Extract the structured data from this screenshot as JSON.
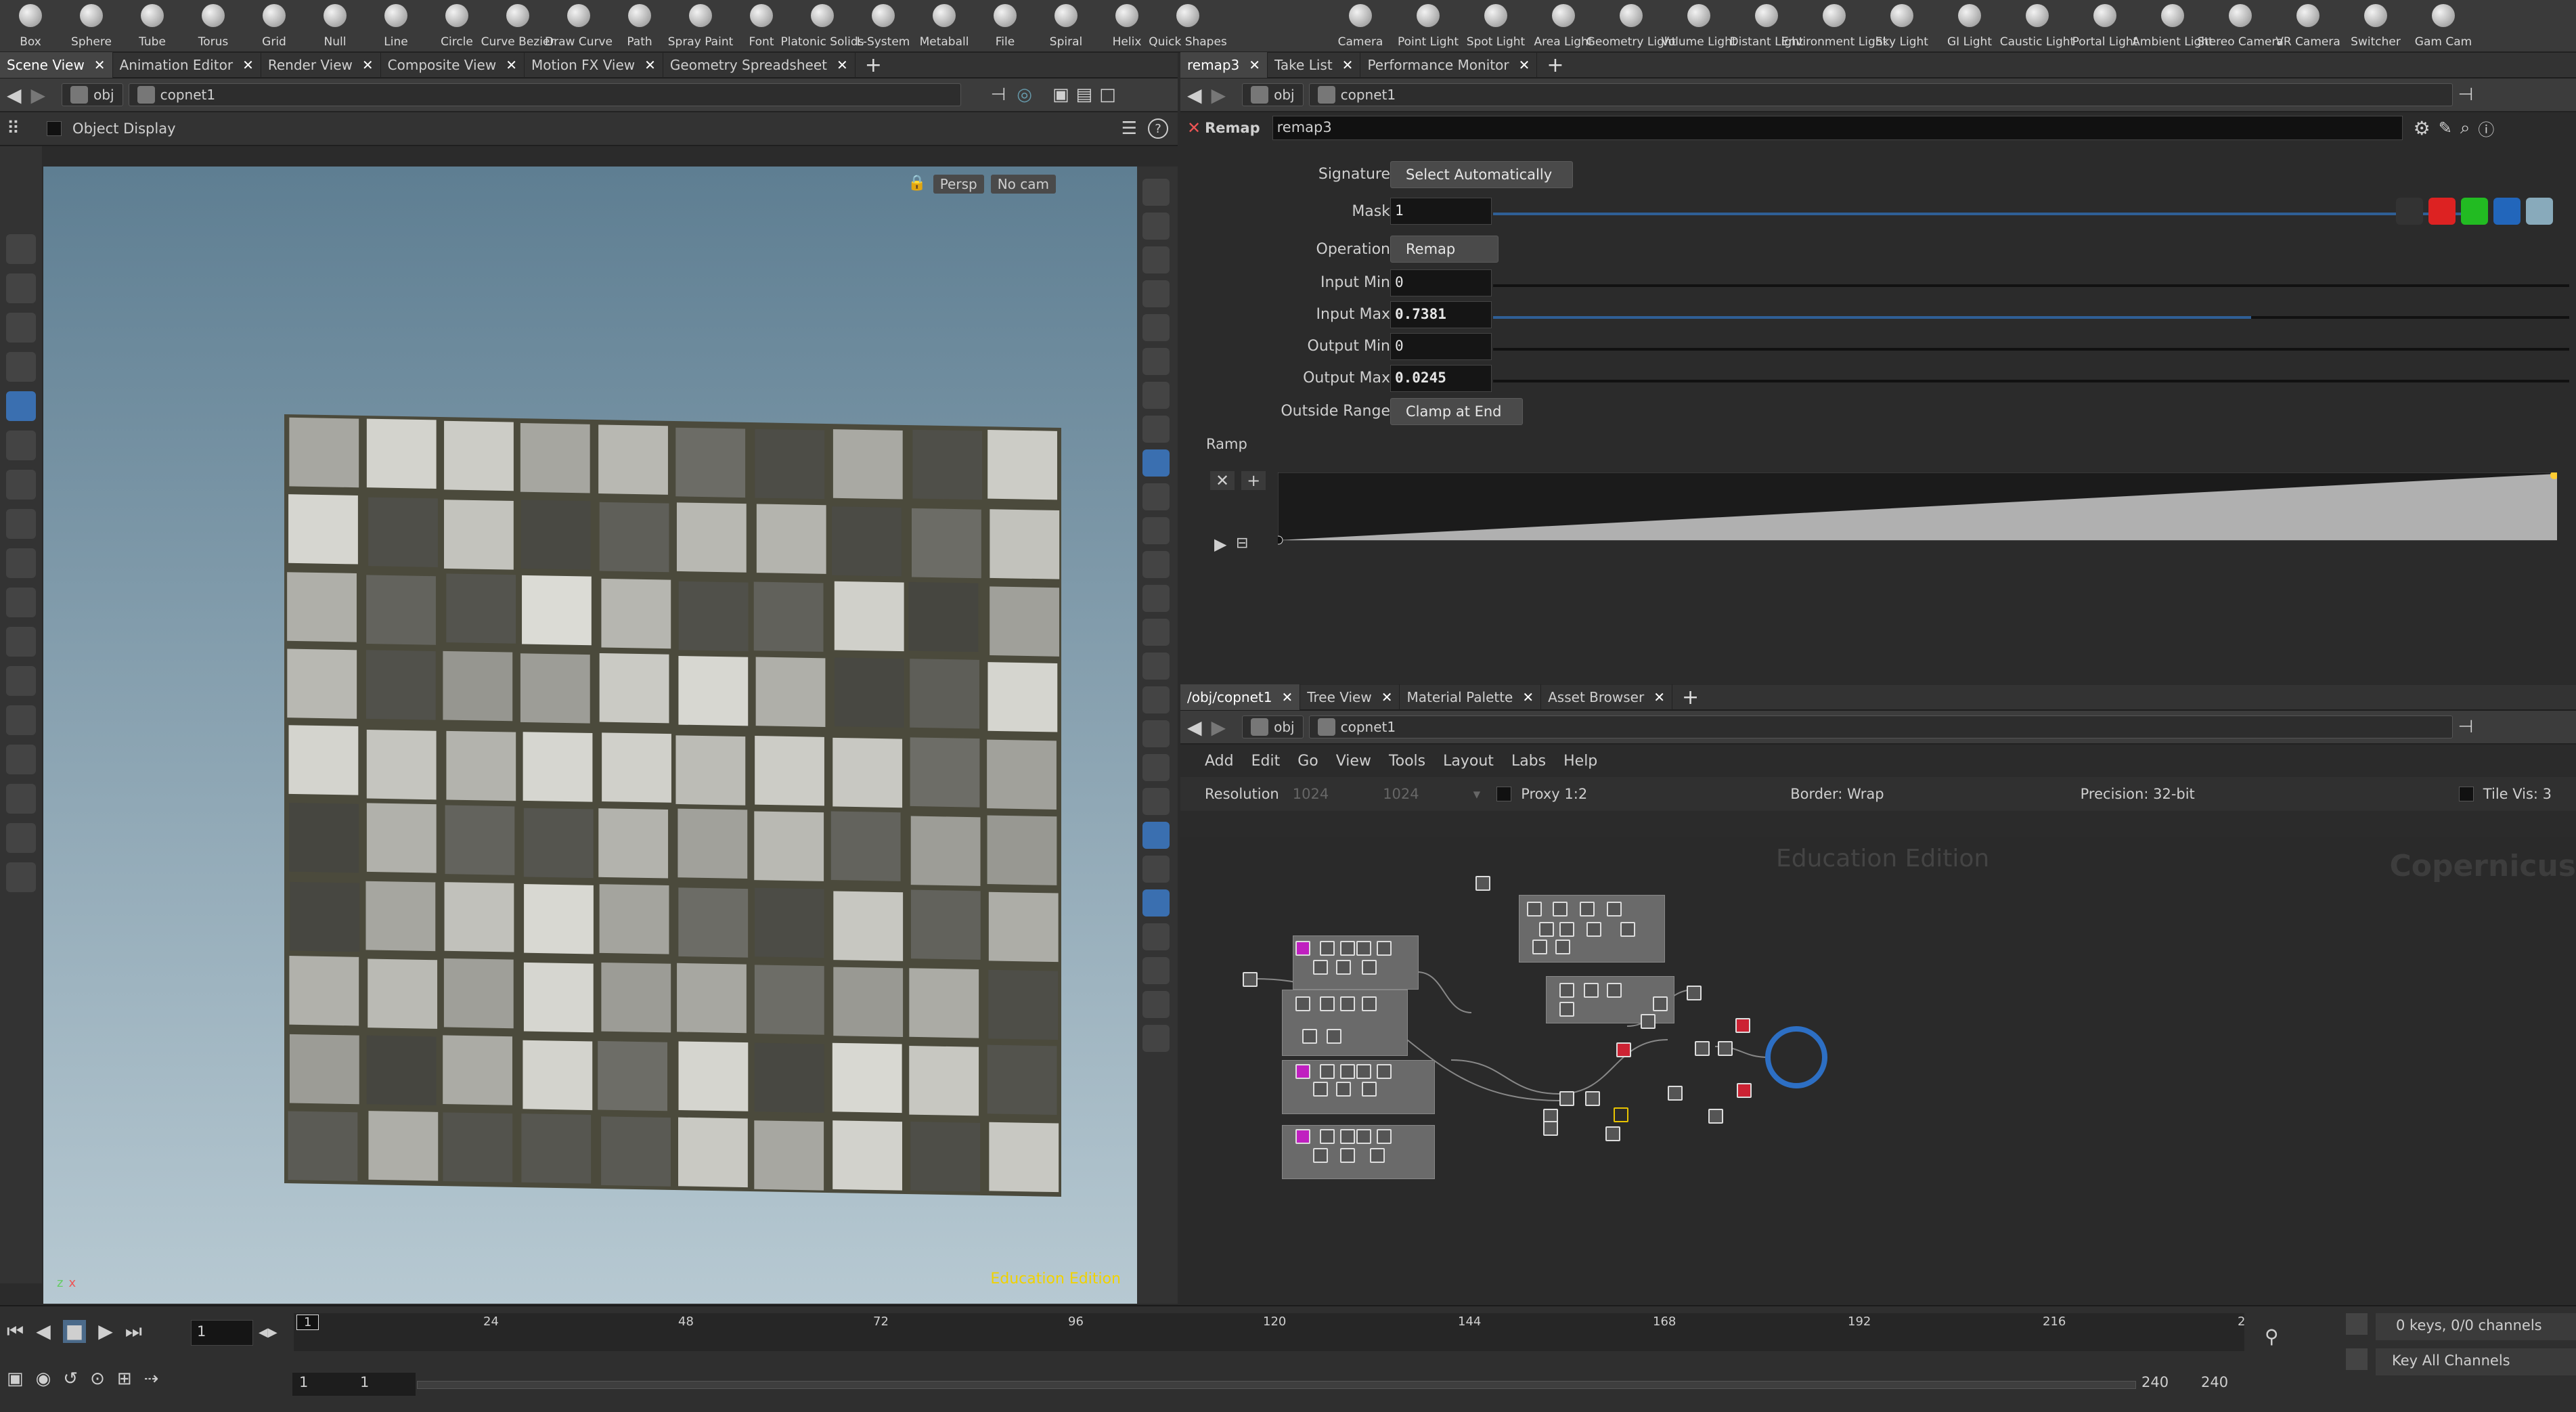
{
  "shelf": {
    "left_tools": [
      {
        "name": "box",
        "label": "Box"
      },
      {
        "name": "sphere",
        "label": "Sphere"
      },
      {
        "name": "tube",
        "label": "Tube"
      },
      {
        "name": "torus",
        "label": "Torus"
      },
      {
        "name": "grid",
        "label": "Grid"
      },
      {
        "name": "null",
        "label": "Null"
      },
      {
        "name": "line",
        "label": "Line"
      },
      {
        "name": "circle",
        "label": "Circle"
      },
      {
        "name": "curve-bezier",
        "label": "Curve Bezier"
      },
      {
        "name": "draw-curve",
        "label": "Draw Curve"
      },
      {
        "name": "path",
        "label": "Path"
      },
      {
        "name": "spray-paint",
        "label": "Spray Paint"
      },
      {
        "name": "font",
        "label": "Font"
      },
      {
        "name": "platonic-solids",
        "label": "Platonic Solids"
      },
      {
        "name": "l-system",
        "label": "L-System"
      },
      {
        "name": "metaball",
        "label": "Metaball"
      },
      {
        "name": "file",
        "label": "File"
      },
      {
        "name": "spiral",
        "label": "Spiral"
      },
      {
        "name": "helix",
        "label": "Helix"
      },
      {
        "name": "quick-shapes",
        "label": "Quick Shapes"
      }
    ],
    "right_tools": [
      {
        "name": "camera",
        "label": "Camera"
      },
      {
        "name": "point-light",
        "label": "Point Light"
      },
      {
        "name": "spot-light",
        "label": "Spot Light"
      },
      {
        "name": "area-light",
        "label": "Area Light"
      },
      {
        "name": "geometry-light",
        "label": "Geometry Light"
      },
      {
        "name": "volume-light",
        "label": "Volume Light"
      },
      {
        "name": "distant-light",
        "label": "Distant Light"
      },
      {
        "name": "environment-light",
        "label": "Environment Light"
      },
      {
        "name": "sky-light",
        "label": "Sky Light"
      },
      {
        "name": "gi-light",
        "label": "GI Light"
      },
      {
        "name": "caustic-light",
        "label": "Caustic Light"
      },
      {
        "name": "portal-light",
        "label": "Portal Light"
      },
      {
        "name": "ambient-light",
        "label": "Ambient Light"
      },
      {
        "name": "stereo-camera",
        "label": "Stereo Camera"
      },
      {
        "name": "vr-camera",
        "label": "VR Camera"
      },
      {
        "name": "switcher",
        "label": "Switcher"
      },
      {
        "name": "gamepad-camera",
        "label": "Gam Cam"
      }
    ]
  },
  "left_pane": {
    "tabs": [
      {
        "label": "Scene View",
        "active": true
      },
      {
        "label": "Animation Editor"
      },
      {
        "label": "Render View"
      },
      {
        "label": "Composite View"
      },
      {
        "label": "Motion FX View"
      },
      {
        "label": "Geometry Spreadsheet"
      }
    ],
    "path": {
      "root": "obj",
      "node": "copnet1"
    },
    "display_label": "Object Display",
    "viewport": {
      "persp": "Persp",
      "cam": "No cam",
      "watermark": "Education Edition",
      "axis_x": "x",
      "axis_z": "z"
    }
  },
  "params_pane": {
    "tabs": [
      {
        "label": "remap3",
        "active": true
      },
      {
        "label": "Take List"
      },
      {
        "label": "Performance Monitor"
      }
    ],
    "path": {
      "root": "obj",
      "node": "copnet1"
    },
    "node_type": "Remap",
    "node_name": "remap3",
    "signature": {
      "label": "Signature",
      "value": "Select Automatically"
    },
    "mask": {
      "label": "Mask",
      "value": "1"
    },
    "operation": {
      "label": "Operation",
      "value": "Remap"
    },
    "input_min": {
      "label": "Input Min",
      "value": "0"
    },
    "input_max": {
      "label": "Input Max",
      "value": "0.7381"
    },
    "output_min": {
      "label": "Output Min",
      "value": "0"
    },
    "output_max": {
      "label": "Output Max",
      "value": "0.0245"
    },
    "outside_range": {
      "label": "Outside Range",
      "value": "Clamp at End"
    },
    "ramp_label": "Ramp"
  },
  "network_pane": {
    "tabs": [
      {
        "label": "/obj/copnet1",
        "active": true
      },
      {
        "label": "Tree View"
      },
      {
        "label": "Material Palette"
      },
      {
        "label": "Asset Browser"
      }
    ],
    "path": {
      "root": "obj",
      "node": "copnet1"
    },
    "menu": [
      "Add",
      "Edit",
      "Go",
      "View",
      "Tools",
      "Layout",
      "Labs",
      "Help"
    ],
    "resolution_label": "Resolution",
    "res_x": "1024",
    "res_y": "1024",
    "proxy": "Proxy 1:2",
    "border": "Border: Wrap",
    "precision": "Precision: 32-bit",
    "tile_vis": "Tile Vis: 3",
    "edu_watermark": "Education Edition",
    "context_watermark": "Copernicus"
  },
  "timeline": {
    "current_frame": "1",
    "ticks": [
      "1",
      "24",
      "48",
      "72",
      "96",
      "120",
      "144",
      "168",
      "192",
      "216",
      "2"
    ],
    "start": "1",
    "start2": "1",
    "end": "240",
    "end2": "240",
    "keys_info": "0 keys, 0/0 channels",
    "key_all": "Key All Channels"
  },
  "colors": {
    "accent_blue": "#3a6fb0",
    "viewport_top": "#5f7f92",
    "viewport_bottom": "#b9cad3",
    "node_selected": "#2d6fc4"
  }
}
